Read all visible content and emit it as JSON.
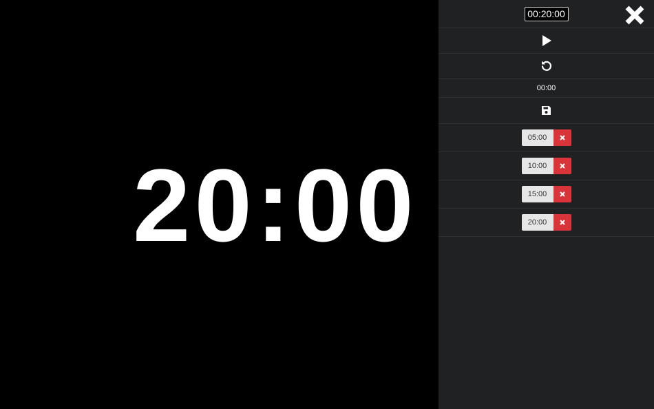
{
  "display": {
    "time": "20:00"
  },
  "panel": {
    "duration_input_value": "00:20:00",
    "elapsed": "00:00",
    "presets": [
      {
        "label": "05:00"
      },
      {
        "label": "10:00"
      },
      {
        "label": "15:00"
      },
      {
        "label": "20:00"
      }
    ]
  },
  "icons": {
    "close": "close-icon",
    "play": "play-icon",
    "reset": "reset-icon",
    "save": "save-icon",
    "delete": "delete-icon"
  },
  "colors": {
    "background": "#000000",
    "panel": "#202123",
    "text": "#ffffff",
    "preset_bg": "#e6e6e6",
    "delete_red": "#d9343a"
  }
}
